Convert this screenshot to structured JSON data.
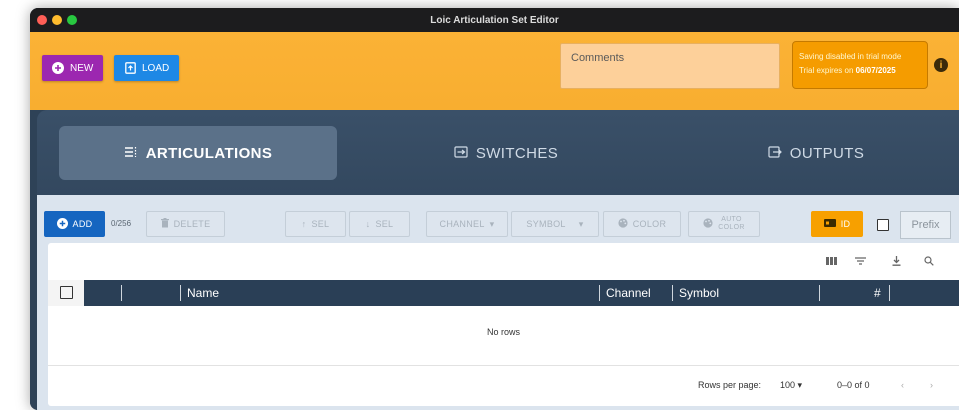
{
  "window": {
    "title": "Loic Articulation Set Editor"
  },
  "colors": {
    "accent_orange": "#fbb236",
    "new_purple": "#9c27b0",
    "load_blue": "#1e88e5",
    "nav_dark": "#2e4257",
    "grid_header": "#2a3f56"
  },
  "header": {
    "new_label": "NEW",
    "load_label": "LOAD",
    "comments_placeholder": "Comments",
    "trial_line1": "Saving disabled in trial mode",
    "trial_line2_prefix": "Trial expires on",
    "trial_date": "06/07/2025"
  },
  "tabs": [
    {
      "label": "ARTICULATIONS",
      "icon": "list-icon",
      "active": true
    },
    {
      "label": "SWITCHES",
      "icon": "switch-icon",
      "active": false
    },
    {
      "label": "OUTPUTS",
      "icon": "output-icon",
      "active": false
    }
  ],
  "toolbar": {
    "add_label": "ADD",
    "count": "0/256",
    "delete_label": "DELETE",
    "sel_up_label": "SEL",
    "sel_down_label": "SEL",
    "channel_label": "CHANNEL",
    "symbol_label": "SYMBOL",
    "color_label": "COLOR",
    "auto_color_line1": "AUTO",
    "auto_color_line2": "COLOR",
    "id_label": "ID",
    "prefix_label": "Prefix"
  },
  "grid": {
    "columns": [
      "Name",
      "Channel",
      "Symbol",
      "#"
    ],
    "empty_text": "No rows",
    "rows_per_page_label": "Rows per page:",
    "rows_per_page_value": "100",
    "pagination": "0–0 of 0"
  }
}
